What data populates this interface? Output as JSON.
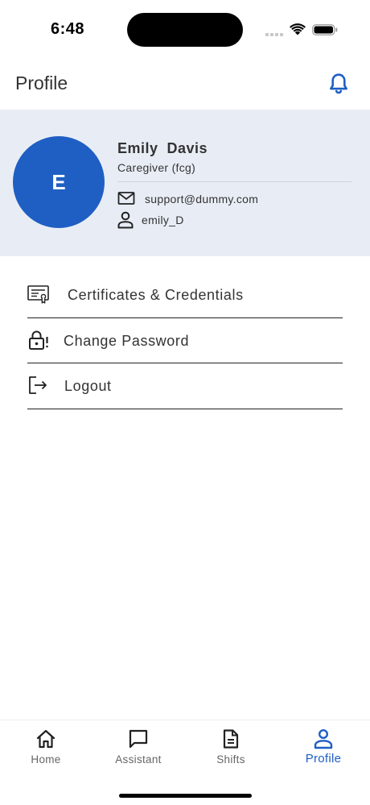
{
  "status_bar": {
    "time": "6:48"
  },
  "header": {
    "title": "Profile"
  },
  "profile": {
    "avatar_initial": "E",
    "name": "Emily  Davis",
    "role": "Caregiver (fcg)",
    "email": "support@dummy.com",
    "username": "emily_D"
  },
  "menu": {
    "items": [
      {
        "label": "Certificates & Credentials",
        "icon": "certificate-icon"
      },
      {
        "label": "Change Password",
        "icon": "lock-alert-icon"
      },
      {
        "label": "Logout",
        "icon": "logout-icon"
      }
    ]
  },
  "nav": {
    "items": [
      {
        "label": "Home",
        "icon": "home-icon"
      },
      {
        "label": "Assistant",
        "icon": "chat-icon"
      },
      {
        "label": "Shifts",
        "icon": "document-icon"
      },
      {
        "label": "Profile",
        "icon": "person-icon"
      }
    ],
    "active": "Profile"
  },
  "colors": {
    "accent": "#1f5fc4",
    "card_background": "#e8edf5",
    "text": "#333333"
  }
}
